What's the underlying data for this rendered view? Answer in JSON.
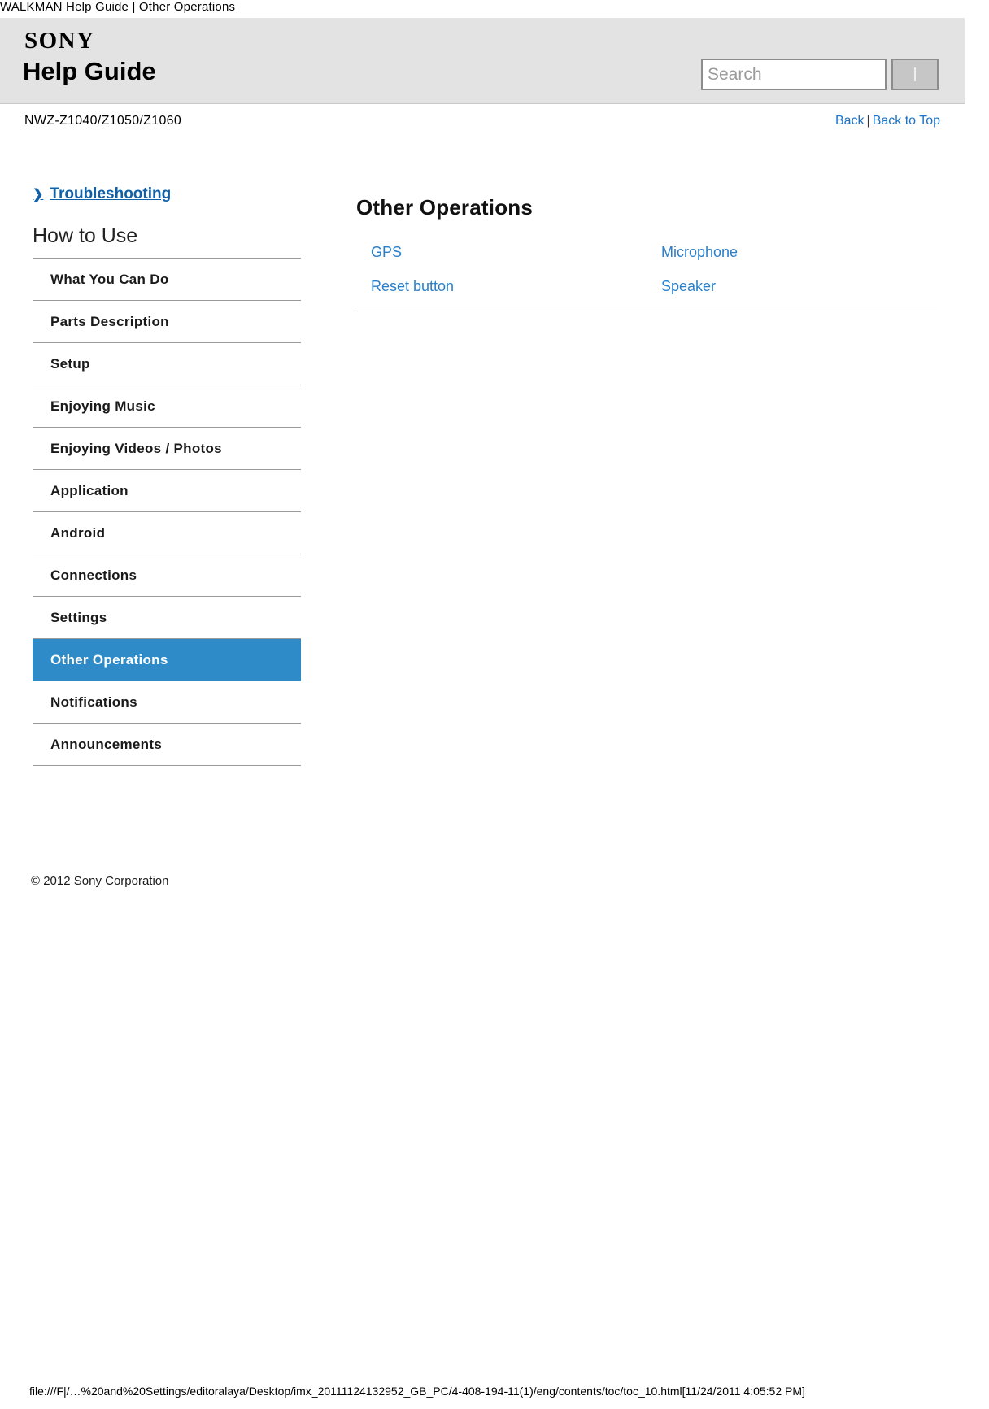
{
  "browser": {
    "document_title": "WALKMAN Help Guide | Other Operations",
    "status_path": "file:///F|/…%20and%20Settings/editoralaya/Desktop/imx_20111124132952_GB_PC/4-408-194-11(1)/eng/contents/toc/toc_10.html[11/24/2011 4:05:52 PM]"
  },
  "header": {
    "brand": "SONY",
    "title": "Help Guide",
    "search_placeholder": "Search",
    "search_value": "",
    "search_button_label": ""
  },
  "model_bar": {
    "model": "NWZ-Z1040/Z1050/Z1060",
    "back_label": "Back",
    "separator": "|",
    "back_to_top_label": "Back to Top"
  },
  "sidebar": {
    "troubleshooting_label": "Troubleshooting",
    "section_heading": "How to Use",
    "items": [
      {
        "label": "What You Can Do",
        "active": false
      },
      {
        "label": "Parts Description",
        "active": false
      },
      {
        "label": "Setup",
        "active": false
      },
      {
        "label": "Enjoying Music",
        "active": false
      },
      {
        "label": "Enjoying Videos / Photos",
        "active": false
      },
      {
        "label": "Application",
        "active": false
      },
      {
        "label": "Android",
        "active": false
      },
      {
        "label": "Connections",
        "active": false
      },
      {
        "label": "Settings",
        "active": false
      },
      {
        "label": "Other Operations",
        "active": true
      },
      {
        "label": "Notifications",
        "active": false
      },
      {
        "label": "Announcements",
        "active": false
      }
    ],
    "copyright": "© 2012 Sony Corporation"
  },
  "main": {
    "title": "Other Operations",
    "rows": [
      {
        "left": "GPS",
        "right": "Microphone"
      },
      {
        "left": "Reset button",
        "right": "Speaker"
      }
    ]
  },
  "colors": {
    "accent_blue": "#2e8bc8",
    "link_blue": "#2a7fc9",
    "header_gray": "#e3e3e3"
  }
}
